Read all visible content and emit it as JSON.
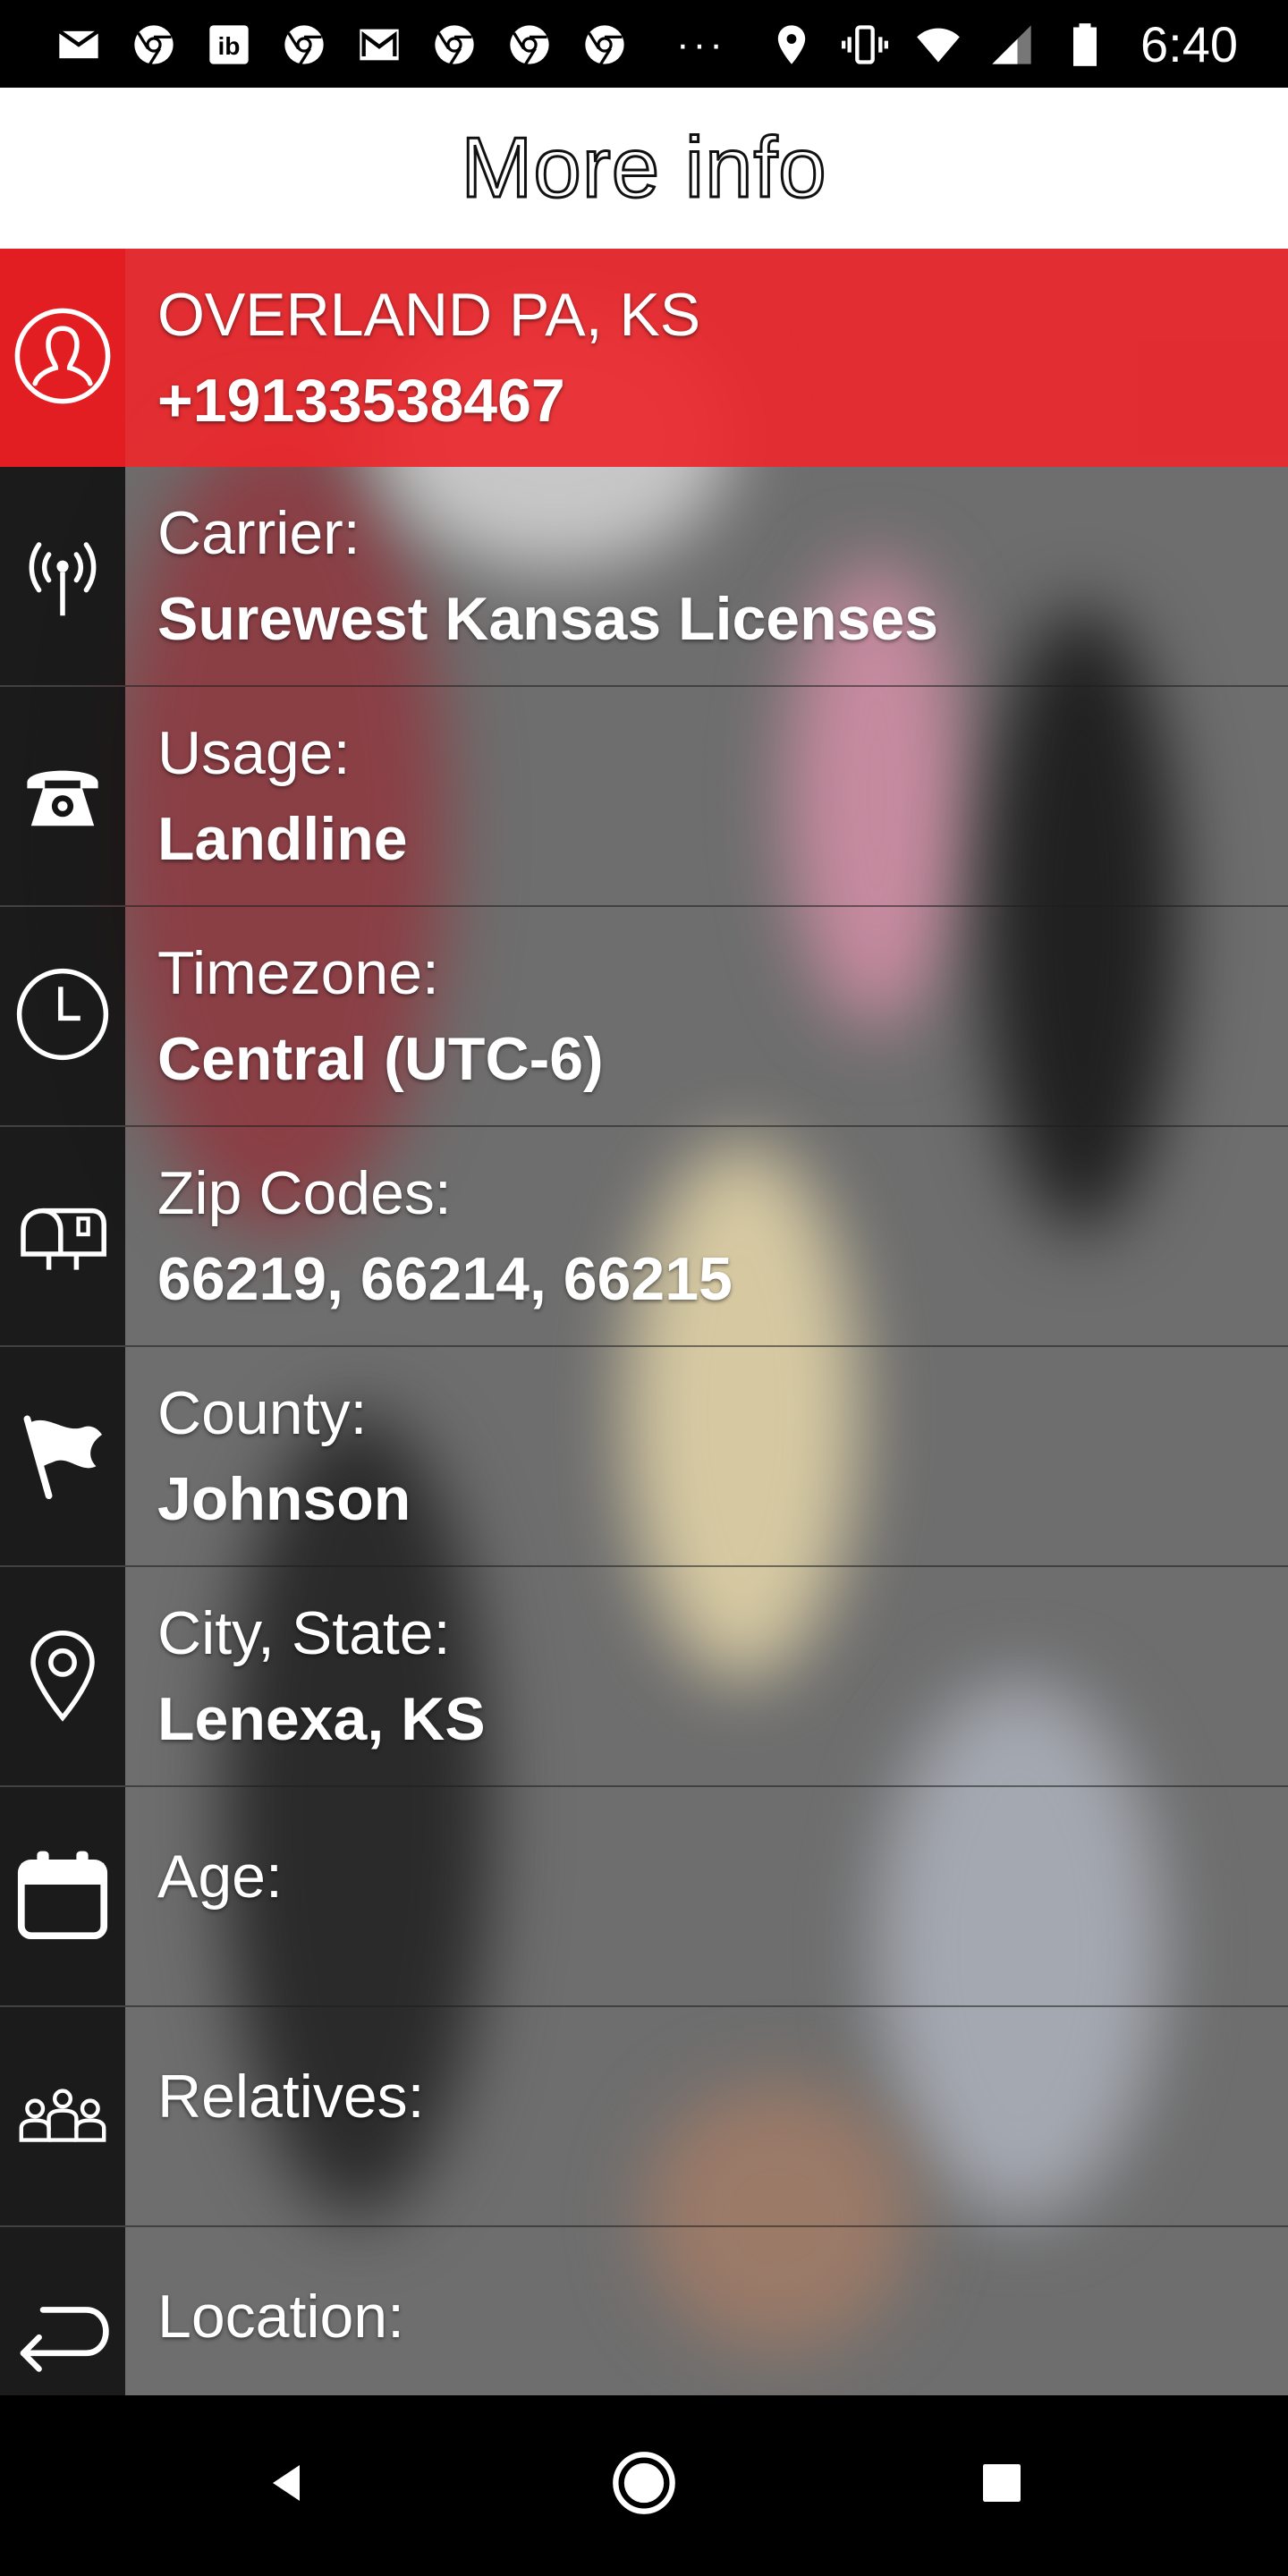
{
  "status_bar": {
    "time": "6:40",
    "left_icons": [
      "mail-icon",
      "chrome-icon",
      "ib-icon",
      "chrome-icon",
      "gmail-icon",
      "chrome-icon",
      "chrome-icon",
      "chrome-icon"
    ],
    "overflow": "···",
    "right_icons": [
      "location-icon",
      "vibrate-icon",
      "wifi-icon",
      "signal-icon",
      "battery-icon"
    ]
  },
  "header": {
    "title": "More info"
  },
  "summary": {
    "location": "OVERLAND PA, KS",
    "phone": "+19133538467",
    "icon": "person-icon"
  },
  "rows": [
    {
      "label": "Carrier:",
      "value": "Surewest Kansas Licenses",
      "icon": "antenna-icon"
    },
    {
      "label": "Usage:",
      "value": "Landline",
      "icon": "telephone-icon"
    },
    {
      "label": "Timezone:",
      "value": "Central (UTC-6)",
      "icon": "clock-icon"
    },
    {
      "label": "Zip Codes:",
      "value": "66219, 66214, 66215",
      "icon": "mailbox-icon"
    },
    {
      "label": "County:",
      "value": "Johnson",
      "icon": "flag-icon"
    },
    {
      "label": "City, State:",
      "value": "Lenexa, KS",
      "icon": "map-pin-icon"
    },
    {
      "label": "Age:",
      "value": "",
      "icon": "calendar-icon"
    },
    {
      "label": "Relatives:",
      "value": "",
      "icon": "people-icon"
    },
    {
      "label": "Location:",
      "value": "",
      "icon": "return-arrow-icon"
    }
  ],
  "colors": {
    "accent_red": "#e8282d",
    "icon_column": "#141414",
    "overlay_gray": "#6e6e6e"
  },
  "nav_bar": {
    "buttons": [
      "back-icon",
      "home-icon",
      "recents-icon"
    ]
  }
}
